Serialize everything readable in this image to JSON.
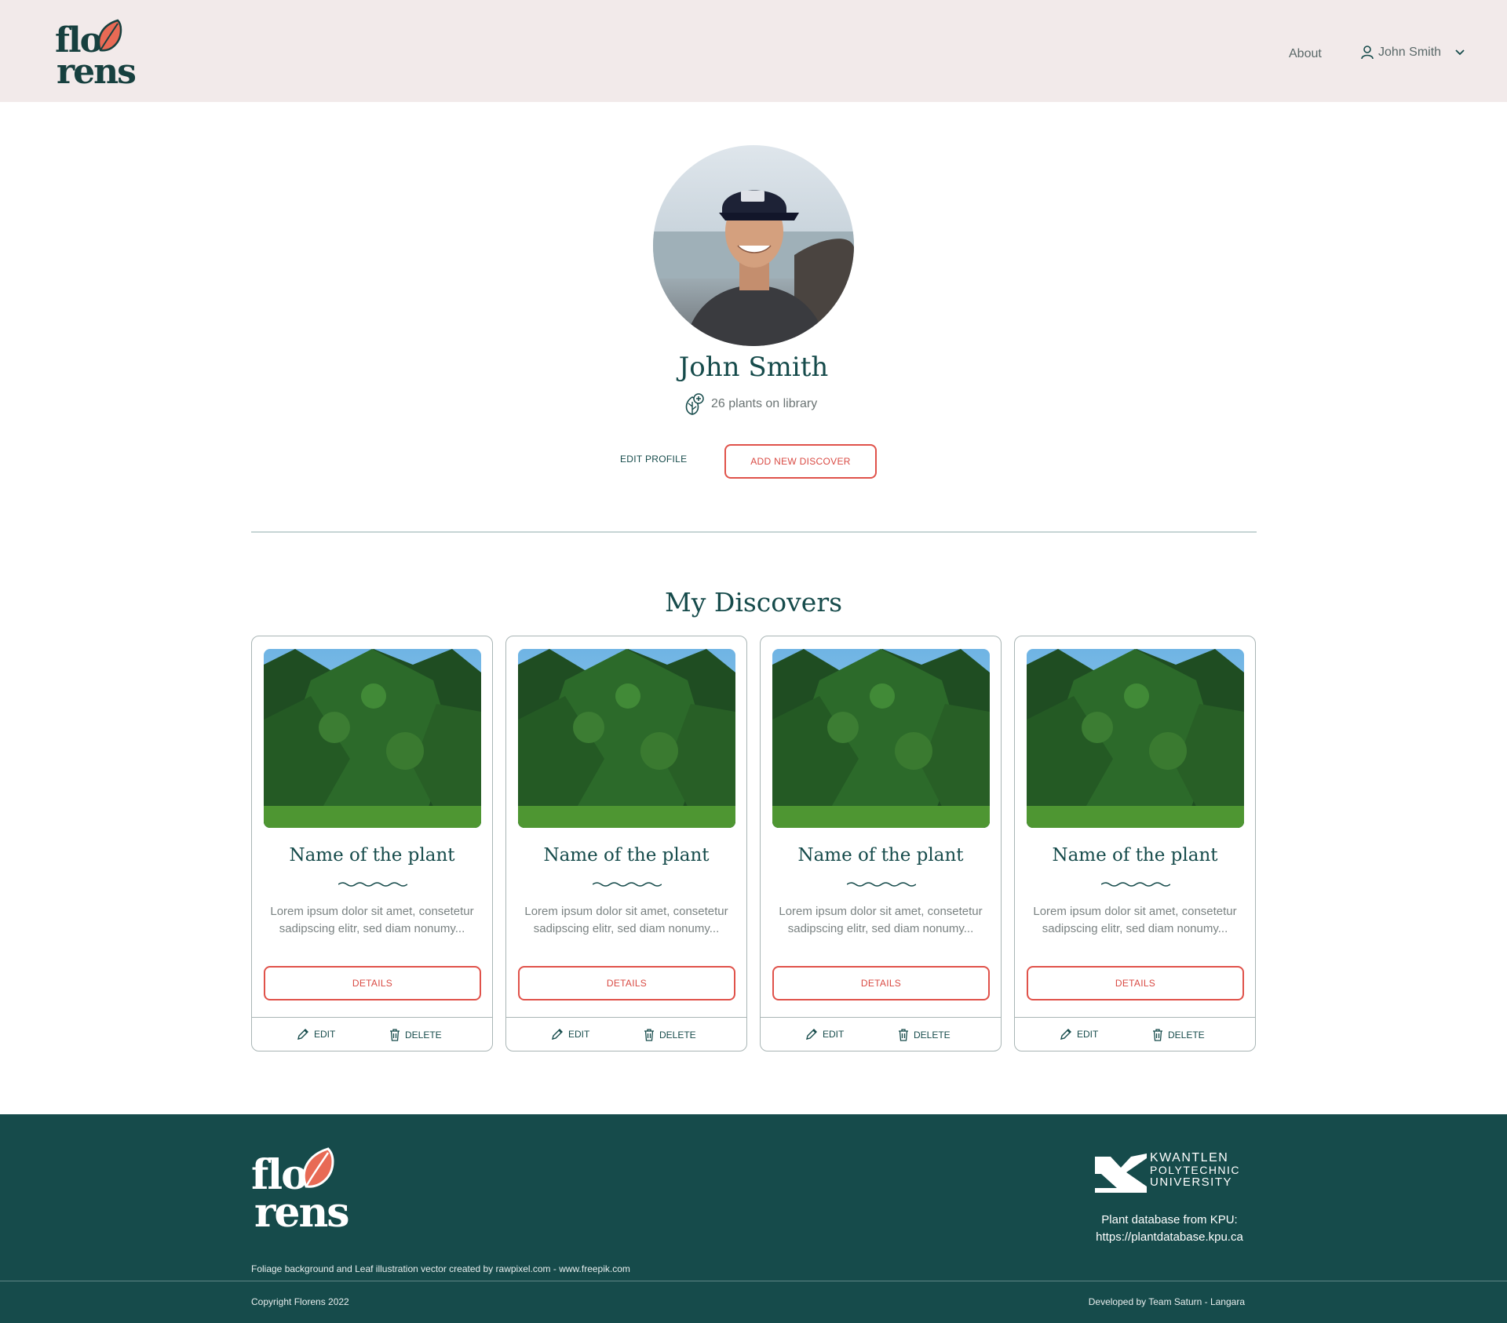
{
  "header": {
    "logo_line1": "flo",
    "logo_line2": "rens",
    "about": "About",
    "user_name": "John Smith"
  },
  "profile": {
    "name": "John Smith",
    "plants_count": "26 plants on library",
    "edit_profile": "EDIT PROFILE",
    "add_new": "ADD NEW DISCOVER"
  },
  "section_title": "My Discovers",
  "cards": [
    {
      "title": "Name of the plant",
      "desc": "Lorem ipsum dolor sit amet, consetetur sadipscing elitr, sed diam nonumy...",
      "details": "DETAILS",
      "edit": "EDIT",
      "delete": "DELETE"
    },
    {
      "title": "Name of the plant",
      "desc": "Lorem ipsum dolor sit amet, consetetur sadipscing elitr, sed diam nonumy...",
      "details": "DETAILS",
      "edit": "EDIT",
      "delete": "DELETE"
    },
    {
      "title": "Name of the plant",
      "desc": "Lorem ipsum dolor sit amet, consetetur sadipscing elitr, sed diam nonumy...",
      "details": "DETAILS",
      "edit": "EDIT",
      "delete": "DELETE"
    },
    {
      "title": "Name of the plant",
      "desc": "Lorem ipsum dolor sit amet, consetetur sadipscing elitr, sed diam nonumy...",
      "details": "DETAILS",
      "edit": "EDIT",
      "delete": "DELETE"
    }
  ],
  "footer": {
    "logo_line1": "flo",
    "logo_line2": "rens",
    "credit": "Foliage background and Leaf illustration vector created by rawpixel.com - www.freepik.com",
    "kpu_line1": "KWANTLEN",
    "kpu_line2": "POLYTECHNIC",
    "kpu_line3": "UNIVERSITY",
    "plantdb_line1": "Plant database from KPU:",
    "plantdb_line2": "https://plantdatabase.kpu.ca",
    "copyright": "Copyright Florens 2022",
    "developed": "Developed by Team Saturn - Langara"
  },
  "colors": {
    "primary": "#164b4b",
    "accent": "#e0524a",
    "header_bg": "#f2eaea",
    "footer_bg": "#164b4b"
  },
  "icons": [
    "leaf-logo-icon",
    "user-icon",
    "chevron-down-icon",
    "plant-add-icon",
    "pencil-icon",
    "trash-icon",
    "kpu-logo-icon"
  ]
}
